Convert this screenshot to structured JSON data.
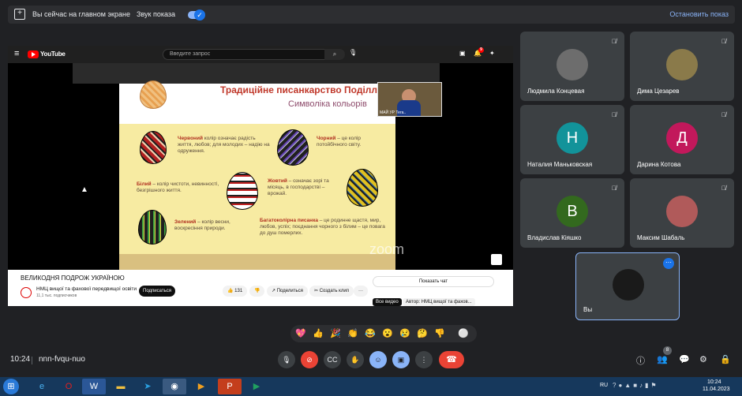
{
  "sharebar": {
    "share_text": "Вы сейчас на главном экране",
    "sound_text": "Звук показа",
    "stop_label": "Остановить показ"
  },
  "youtube": {
    "logo_text": "YouTube",
    "search_placeholder": "Введите запрос",
    "video_title": "ВЕЛИКОДНЯ ПОДРОЖ УКРАЇНОЮ",
    "channel": "НМЦ вищої та фахової передвищої освіти",
    "subs": "11,1 тыс. подписчиков",
    "subscribe": "Подписаться",
    "likes": "131",
    "share": "Поделиться",
    "clip": "Создать клип",
    "more": "···",
    "chat": "Показать чат",
    "tab_all": "Все видео",
    "tab_author": "Автор: НМЦ вищої та фахов..."
  },
  "slide": {
    "title": "Традиційне писанкарство Поділля",
    "subtitle": "Символіка кольорів",
    "t_red_b": "Червоний",
    "t_red": " колір означає радість життя, любов; для молодих – надію на одруження.",
    "t_black_b": "Чорний",
    "t_black": " – це колір потойбічного світу.",
    "t_white_b": "Білий",
    "t_white": " – колір чистоти, невинності, безгрішного життя.",
    "t_yellow_b": "Жовтий",
    "t_yellow": " – означає зорі та місяць, в господарстві – врожай.",
    "t_green_b": "Зелений",
    "t_green": " – колір весни, воскресіння природи.",
    "t_multi_b": "Багатоколірна писанка",
    "t_multi": " – це родинне щастя, мир, любов, успіх; поєднання чорного з білим – це повага до душ померлих.",
    "webcam_label": "МАЙ УР Тега.."
  },
  "zoom_watermark": "zoom",
  "participants": [
    {
      "name": "Людмила Концевая",
      "initial": "",
      "color": "#777"
    },
    {
      "name": "Дима Цезарев",
      "initial": "",
      "color": "#8a7a4a"
    },
    {
      "name": "Наталия Маньковская",
      "initial": "Н",
      "color": "#12939a"
    },
    {
      "name": "Дарина Котова",
      "initial": "Д",
      "color": "#c2185b"
    },
    {
      "name": "Владислав Кіяшко",
      "initial": "В",
      "color": "#33691e"
    },
    {
      "name": "Максим Шабаль",
      "initial": "",
      "color": "#b05a5a"
    }
  ],
  "self": {
    "name": "Вы"
  },
  "reactions": [
    "💖",
    "👍",
    "🎉",
    "👏",
    "😂",
    "😮",
    "😢",
    "🤔",
    "👎",
    "⚪"
  ],
  "meeting": {
    "time": "10:24",
    "code": "nnn-fvqu-nuo",
    "people_count": "8"
  },
  "tray": {
    "lang": "RU",
    "time": "10:24",
    "date": "11.04.2023"
  }
}
